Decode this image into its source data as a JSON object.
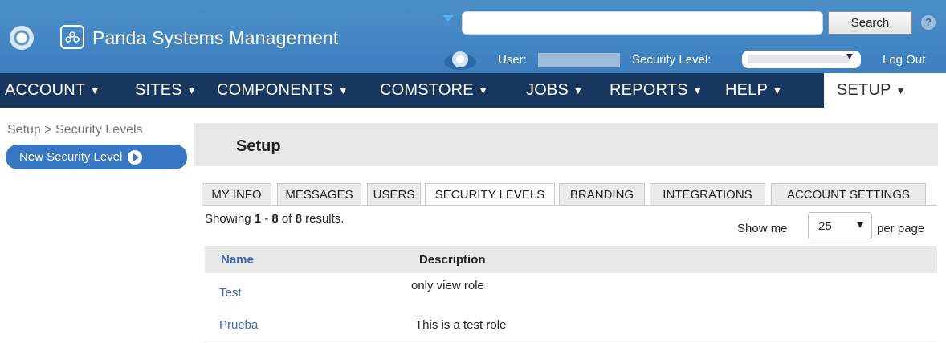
{
  "header": {
    "brand": "Panda Systems Management",
    "search_placeholder": "",
    "search_button": "Search",
    "help": "?",
    "user_label": "User:",
    "security_label": "Security Level:",
    "logout": "Log Out"
  },
  "nav": [
    {
      "label": "ACCOUNT"
    },
    {
      "label": "SITES"
    },
    {
      "label": "COMPONENTS"
    },
    {
      "label": "COMSTORE"
    },
    {
      "label": "JOBS"
    },
    {
      "label": "REPORTS"
    },
    {
      "label": "HELP"
    },
    {
      "label": "SETUP"
    }
  ],
  "nav_caret": "▼",
  "sidebar": {
    "breadcrumb": "Setup > Security Levels",
    "new_button": "New Security Level"
  },
  "main": {
    "title": "Setup",
    "tabs": [
      {
        "label": "MY INFO"
      },
      {
        "label": "MESSAGES"
      },
      {
        "label": "USERS"
      },
      {
        "label": "SECURITY LEVELS"
      },
      {
        "label": "BRANDING"
      },
      {
        "label": "INTEGRATIONS"
      },
      {
        "label": "ACCOUNT SETTINGS"
      }
    ],
    "active_tab": "SECURITY LEVELS",
    "showing": {
      "prefix": "Showing ",
      "from": "1",
      "sep": " - ",
      "to": "8",
      "of": " of ",
      "total": "8",
      "suffix": " results."
    },
    "show_me": "Show me",
    "per_page_value": "25",
    "per_page": "per page",
    "table": {
      "columns": [
        "Name",
        "Description"
      ],
      "rows": [
        {
          "name": "Test",
          "description": "only view role"
        },
        {
          "name": "Prueba",
          "description": "This is a test role"
        }
      ]
    }
  },
  "colors": {
    "header_blue": "#4189c6",
    "nav_dark": "#17375f",
    "link_blue": "#3d67b5",
    "button_blue": "#3877c3"
  }
}
